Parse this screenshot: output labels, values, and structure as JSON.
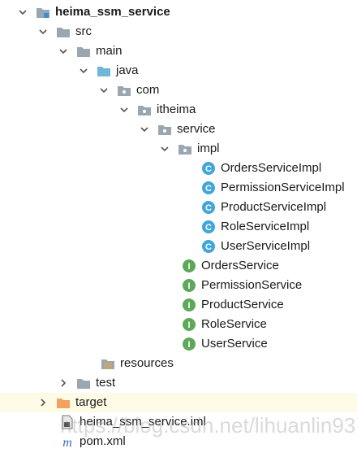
{
  "tree": {
    "project": {
      "label": "heima_ssm_service"
    },
    "src": {
      "label": "src"
    },
    "main": {
      "label": "main"
    },
    "java": {
      "label": "java"
    },
    "com": {
      "label": "com"
    },
    "itheima": {
      "label": "itheima"
    },
    "service": {
      "label": "service"
    },
    "impl": {
      "label": "impl"
    },
    "impl_classes": [
      {
        "label": "OrdersServiceImpl",
        "icon": "class-icon"
      },
      {
        "label": "PermissionServiceImpl",
        "icon": "class-icon"
      },
      {
        "label": "ProductServiceImpl",
        "icon": "class-icon"
      },
      {
        "label": "RoleServiceImpl",
        "icon": "class-icon"
      },
      {
        "label": "UserServiceImpl",
        "icon": "class-icon"
      }
    ],
    "interfaces": [
      {
        "label": "OrdersService",
        "icon": "interface-icon"
      },
      {
        "label": "PermissionService",
        "icon": "interface-icon"
      },
      {
        "label": "ProductService",
        "icon": "interface-icon"
      },
      {
        "label": "RoleService",
        "icon": "interface-icon"
      },
      {
        "label": "UserService",
        "icon": "interface-icon"
      }
    ],
    "resources": {
      "label": "resources"
    },
    "test": {
      "label": "test"
    },
    "target": {
      "label": "target"
    },
    "iml_file": {
      "label": "heima_ssm_service.iml"
    },
    "pom_file": {
      "label": "pom.xml"
    }
  },
  "watermark": "https://blog.csdn.net/lihuanlin93",
  "colors": {
    "selected_row": "#fdfbe6",
    "folder": "#9aa7b0",
    "source_folder": "#6fb7d9",
    "excluded_folder": "#f0a25e",
    "class_badge": "#41a6d9",
    "interface_badge": "#5fa85a"
  }
}
